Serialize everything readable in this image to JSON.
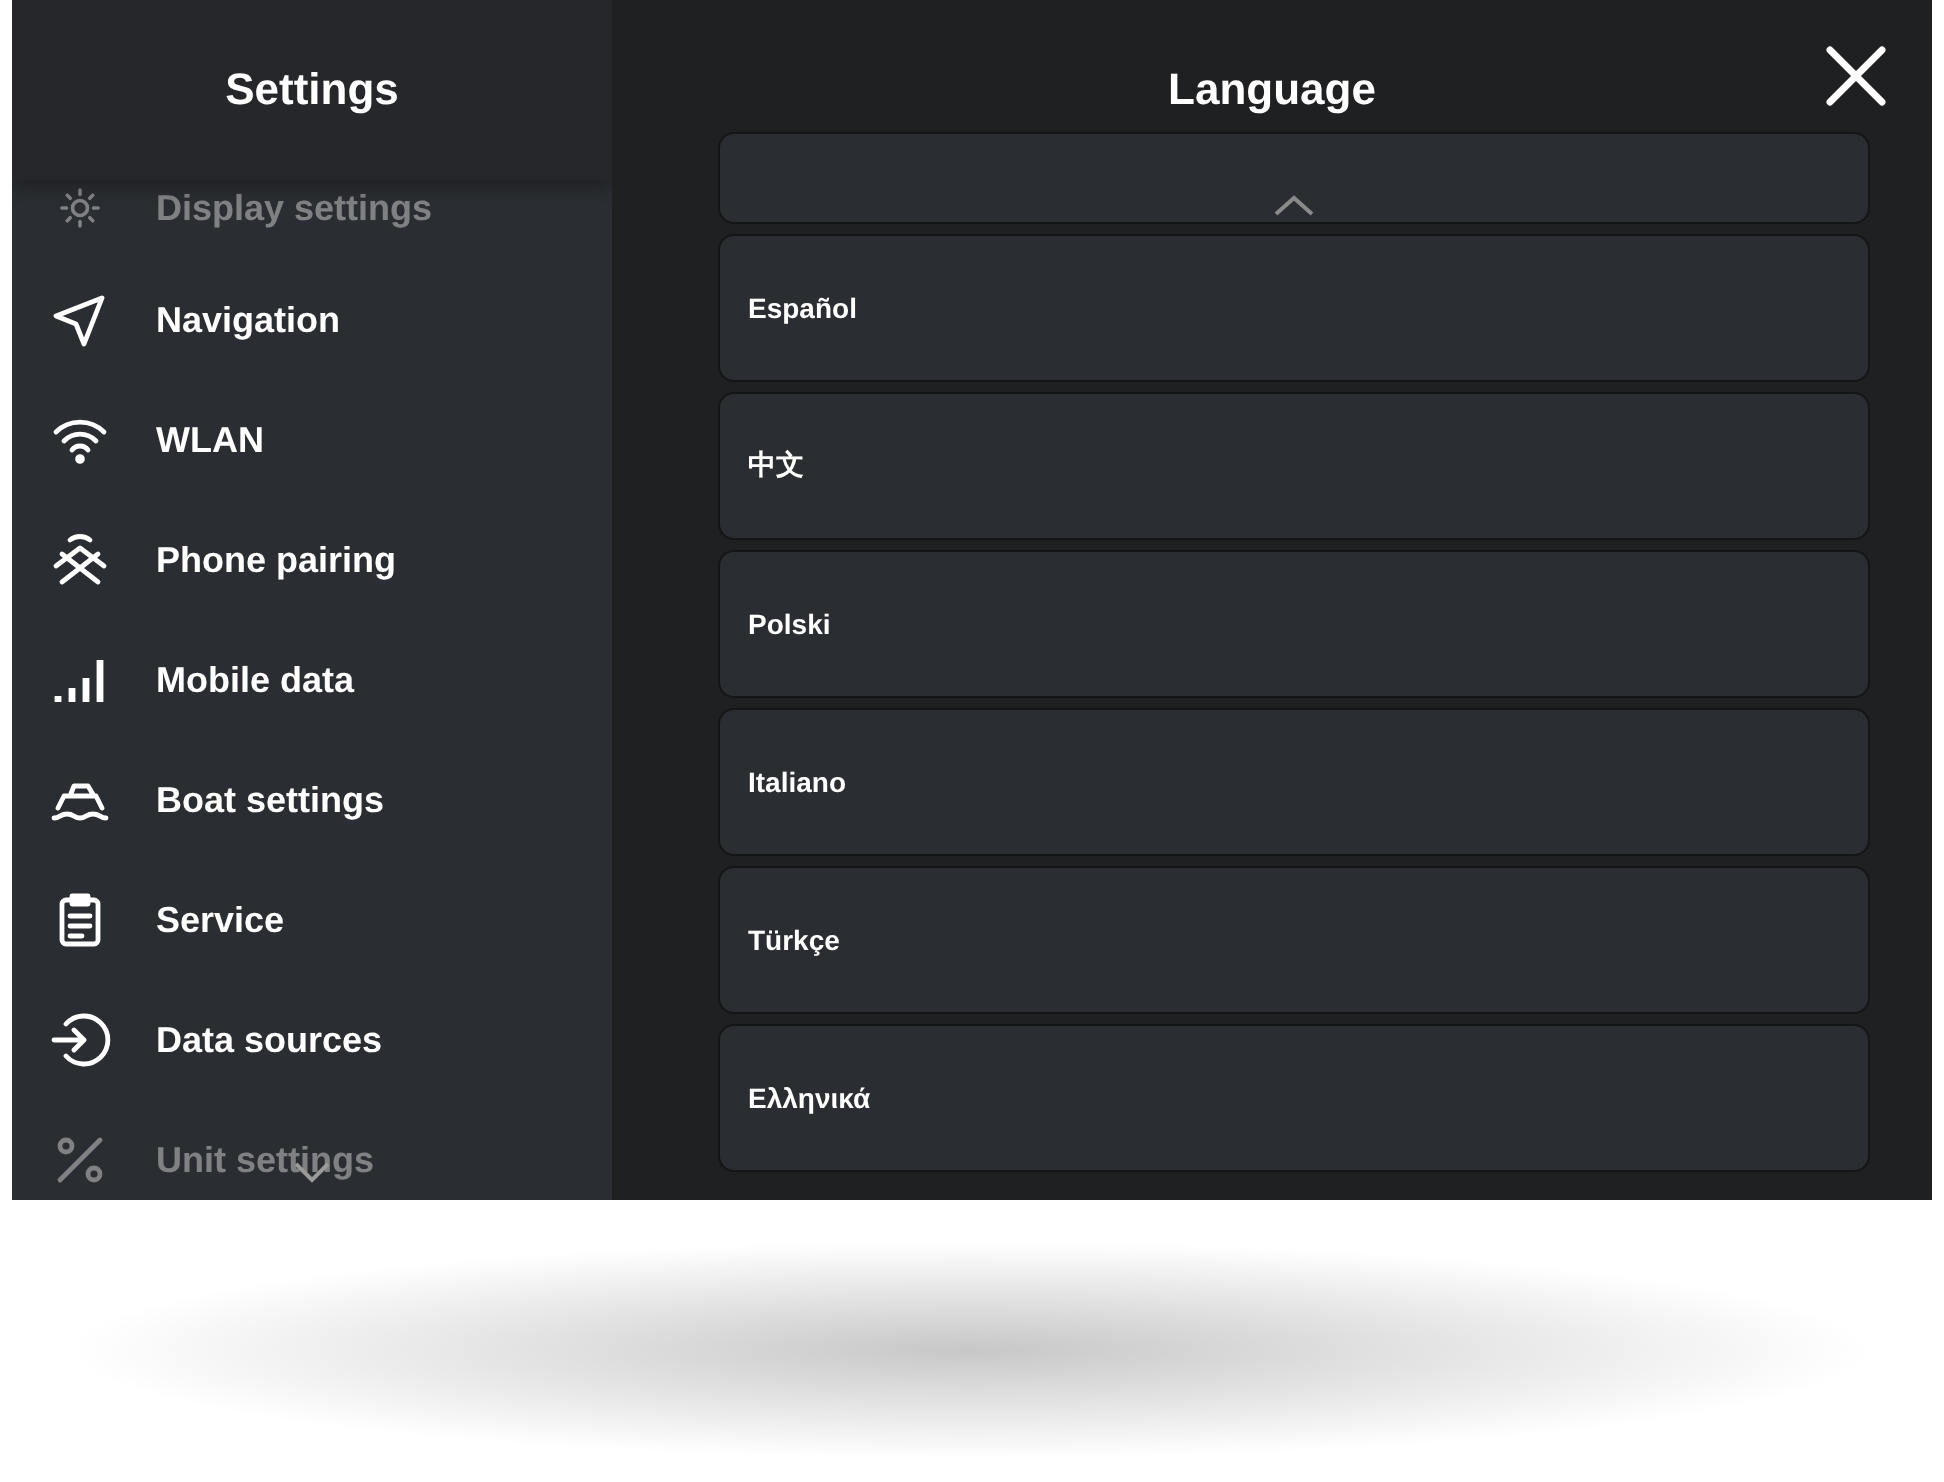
{
  "sidebar": {
    "title": "Settings",
    "items": [
      {
        "label": "Display settings",
        "faded": true
      },
      {
        "label": "Navigation",
        "faded": false
      },
      {
        "label": "WLAN",
        "faded": false
      },
      {
        "label": "Phone pairing",
        "faded": false
      },
      {
        "label": "Mobile data",
        "faded": false
      },
      {
        "label": "Boat settings",
        "faded": false
      },
      {
        "label": "Service",
        "faded": false
      },
      {
        "label": "Data sources",
        "faded": false
      },
      {
        "label": "Unit settings",
        "faded": true
      }
    ]
  },
  "panel": {
    "title": "Language",
    "languages": [
      "Español",
      "中文",
      "Polski",
      "Italiano",
      "Türkçe",
      "Ελληνικά"
    ]
  }
}
